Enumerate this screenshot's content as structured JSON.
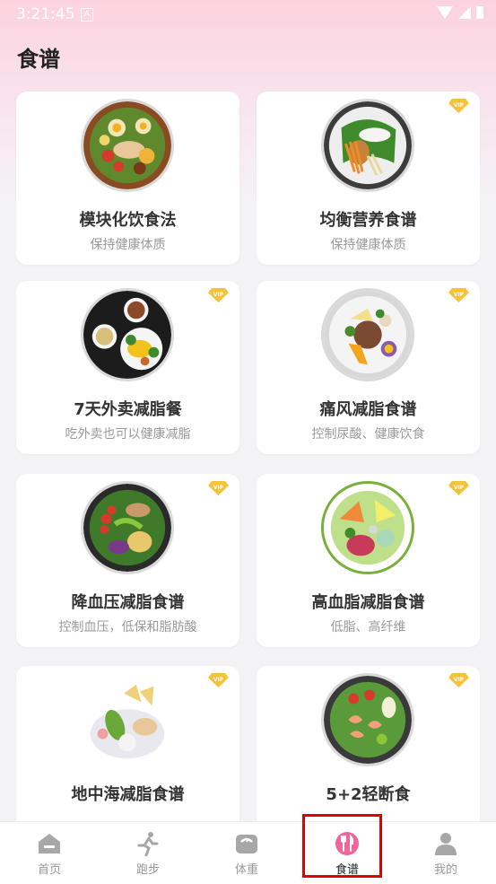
{
  "status_bar": {
    "time": "3:21:45",
    "badge": "A"
  },
  "header": {
    "title": "食谱"
  },
  "recipes": [
    {
      "name": "模块化饮食法",
      "desc": "保持健康体质",
      "vip": false,
      "photo_icon": "salad-bowl-photo"
    },
    {
      "name": "均衡营养食谱",
      "desc": "保持健康体质",
      "vip": true,
      "photo_icon": "chicken-greens-photo"
    },
    {
      "name": "7天外卖减脂餐",
      "desc": "吃外卖也可以健康减脂",
      "vip": true,
      "photo_icon": "takeout-meal-photo"
    },
    {
      "name": "痛风减脂食谱",
      "desc": "控制尿酸、健康饮食",
      "vip": true,
      "photo_icon": "grain-bowl-photo"
    },
    {
      "name": "降血压减脂食谱",
      "desc": "控制血压，低保和脂肪酸",
      "vip": true,
      "photo_icon": "veggie-bowl-photo"
    },
    {
      "name": "高血脂减脂食谱",
      "desc": "低脂、高纤维",
      "vip": true,
      "photo_icon": "fresh-salad-photo"
    },
    {
      "name": "地中海减脂食谱",
      "desc": "",
      "vip": true,
      "photo_icon": "mediterranean-bowl-photo"
    },
    {
      "name": "5+2轻断食",
      "desc": "",
      "vip": true,
      "photo_icon": "shrimp-salad-photo"
    }
  ],
  "vip_badge": "VIP",
  "tabs": [
    {
      "label": "首页",
      "icon": "home-icon",
      "active": false
    },
    {
      "label": "跑步",
      "icon": "running-icon",
      "active": false
    },
    {
      "label": "体重",
      "icon": "scale-icon",
      "active": false
    },
    {
      "label": "食谱",
      "icon": "recipe-icon",
      "active": true
    },
    {
      "label": "我的",
      "icon": "profile-icon",
      "active": false
    }
  ],
  "colors": {
    "accent": "#f0659b",
    "vip_gold": "#f5c23c",
    "highlight_red": "#e00000"
  }
}
